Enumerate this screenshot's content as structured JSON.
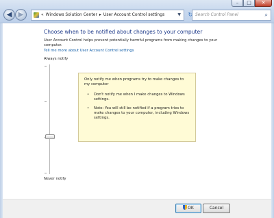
{
  "window": {
    "caption_buttons": {
      "minimize": "–",
      "maximize": "□",
      "close": "✕"
    }
  },
  "nav": {
    "back_icon": "arrow-left-icon",
    "forward_icon": "arrow-right-icon"
  },
  "address_bar": {
    "overflow": "«",
    "breadcrumb": [
      "Windows Solution Center",
      "User Account Control settings"
    ],
    "separator": "▸"
  },
  "search": {
    "placeholder": "Search Control Panel"
  },
  "content": {
    "heading": "Choose when to be notified about changes to your computer",
    "description": "User Account Control helps prevent potentially harmful programs from making changes to your computer.",
    "help_link": "Tell me more about User Account Control settings",
    "slider": {
      "top_label": "Always notify",
      "bottom_label": "Never notify",
      "levels": 4,
      "selected_level": 2
    },
    "info_box": {
      "title": "Only notify me when programs try to make changes to my computer",
      "bullets": [
        "Don't notify me when I make changes to Windows settings.",
        "Note: You will still be notified if a program tries to make changes to your computer, including Windows settings."
      ]
    }
  },
  "buttons": {
    "ok": "OK",
    "cancel": "Cancel"
  },
  "colors": {
    "heading": "#1e3a8a",
    "link": "#0b5aa6",
    "info_bg": "#fffbd6"
  }
}
